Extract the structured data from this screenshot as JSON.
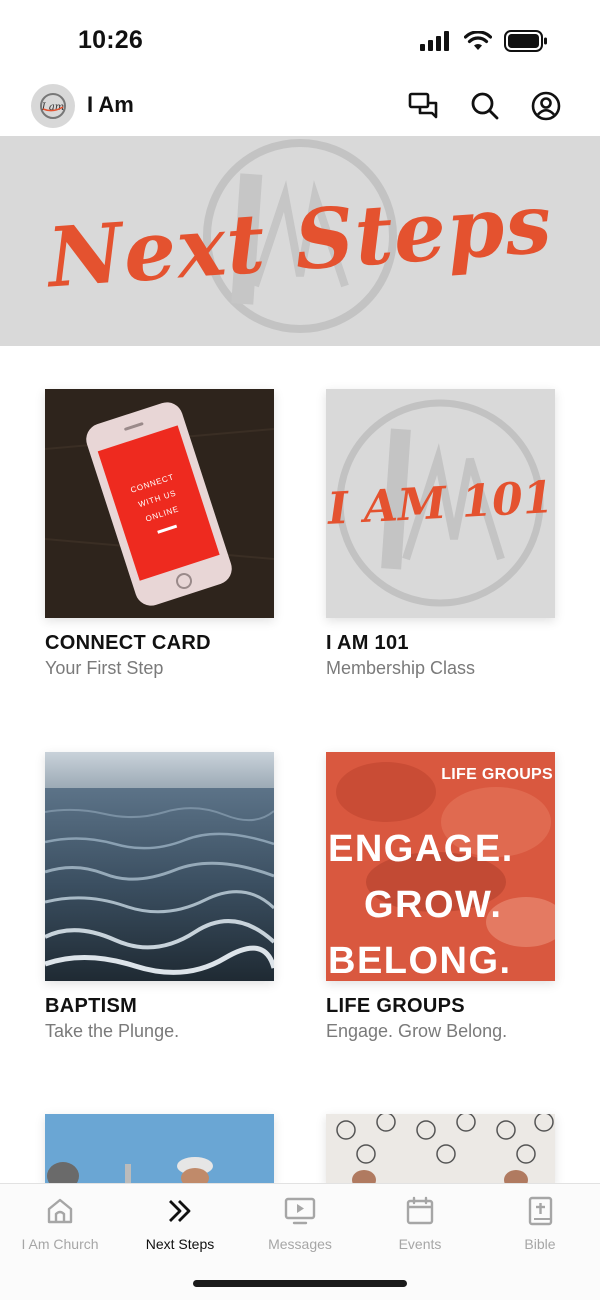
{
  "status": {
    "time": "10:26"
  },
  "header": {
    "title": "I Am",
    "logo_text": "I am"
  },
  "banner": {
    "text": "Next Steps"
  },
  "cards": [
    {
      "title": "CONNECT CARD",
      "subtitle": "Your First Step",
      "image_text": "CONNECT WITH US ONLINE"
    },
    {
      "title": "I AM 101",
      "subtitle": "Membership Class",
      "image_text": "I AM 101"
    },
    {
      "title": "BAPTISM",
      "subtitle": "Take the Plunge."
    },
    {
      "title": "LIFE GROUPS",
      "subtitle": "Engage. Grow Belong.",
      "image_badge": "LIFE GROUPS",
      "image_lines": [
        "ENGAGE.",
        "GROW.",
        "BELONG."
      ]
    }
  ],
  "tabs": [
    {
      "label": "I Am Church",
      "icon": "home-icon"
    },
    {
      "label": "Next Steps",
      "icon": "double-chevron-icon",
      "active": true
    },
    {
      "label": "Messages",
      "icon": "play-screen-icon"
    },
    {
      "label": "Events",
      "icon": "calendar-icon"
    },
    {
      "label": "Bible",
      "icon": "bible-icon"
    }
  ],
  "colors": {
    "accent": "#e4522f",
    "banner_bg": "#d9d9d9",
    "tab_inactive": "#a6a6a6"
  }
}
